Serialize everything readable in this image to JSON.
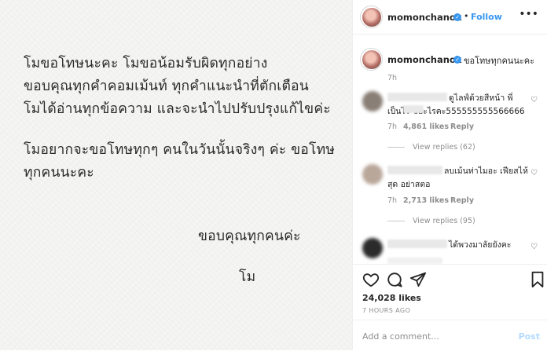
{
  "photo": {
    "lines": [
      "โมขอโทษนะคะ โมขอน้อมรับผิดทุกอย่าง",
      "ขอบคุณทุกคำคอมเม้นท์ ทุกคำแนะนำที่ตักเตือน",
      "โมได้อ่านทุกข้อความ และจะนำไปปรับปรุงแก้ไขค่ะ",
      "โมอยากจะขอโทษทุกๆ คนในวันนั้นจริงๆ ค่ะ ขอโทษ",
      "ทุกคนนะคะ",
      "ขอบคุณทุกคนค่ะ",
      "โม"
    ]
  },
  "header": {
    "username": "momonchanok",
    "separator": "•",
    "follow_label": "Follow"
  },
  "caption": {
    "username": "momonchanok",
    "text": "ขอโทษทุกคนนะคะ",
    "time": "7h"
  },
  "comments": [
    {
      "text_line1": "ดูไลฟ์ด้วยสีหน้า พี่",
      "text_line2": "เป็นไร ขอะไรคะ555555555566666",
      "time": "7h",
      "likes": "4,861 likes",
      "reply_label": "Reply",
      "view_replies": "View replies (62)",
      "avatar_color": "#8a7f76"
    },
    {
      "text_line1": "ลบเม้นท่าไมอะ เฟียสไห้",
      "text_line2": "สุด อย่าสตอ",
      "time": "7h",
      "likes": "2,713 likes",
      "reply_label": "Reply",
      "view_replies": "View replies (95)",
      "avatar_color": "#b9a79a"
    },
    {
      "text_line1": "ได้พวงมาลัยยังคะ",
      "text_line2": "",
      "time": "",
      "likes": "",
      "reply_label": "",
      "view_replies": "",
      "avatar_color": "#2b2b2b"
    }
  ],
  "actions": {
    "like_icon": "heart-icon",
    "comment_icon": "comment-icon",
    "share_icon": "share-icon",
    "save_icon": "bookmark-icon",
    "likes_count": "24,028 likes",
    "posted_ago": "7 HOURS AGO"
  },
  "add_comment": {
    "placeholder": "Add a comment...",
    "post_label": "Post"
  },
  "colors": {
    "accent": "#3897f0",
    "muted": "#8e8e8e",
    "text": "#262626",
    "divider": "#efefef"
  }
}
